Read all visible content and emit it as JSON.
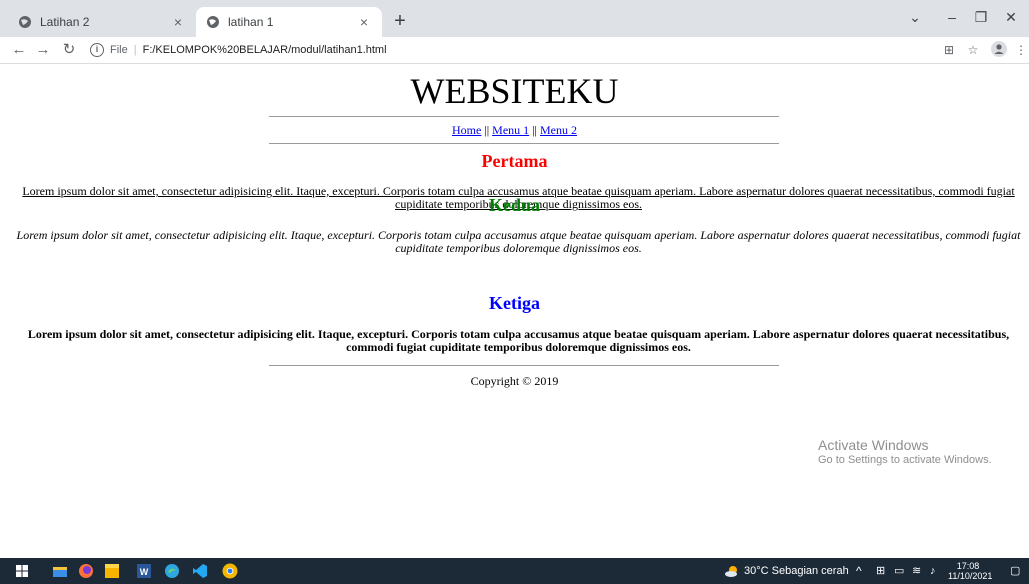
{
  "browser": {
    "tabs": [
      {
        "label": "Latihan 2",
        "close": "×",
        "active": false
      },
      {
        "label": "latihan 1",
        "close": "×",
        "active": true
      }
    ],
    "new_tab": "+",
    "window_controls": {
      "dropdown": "⌄",
      "minimize": "–",
      "restore": "❐",
      "close": "✕"
    },
    "url": {
      "scheme": "File",
      "path": "F:/KELOMPOK%20BELAJAR/modul/latihan1.html"
    }
  },
  "page": {
    "title": "WEBSITEKU",
    "nav": [
      {
        "label": "Home"
      },
      {
        "label": "Menu 1"
      },
      {
        "label": "Menu 2"
      }
    ],
    "nav_separator": "||",
    "sections": [
      {
        "heading": "Pertama",
        "color": "#ff0000",
        "text": "Lorem ipsum dolor sit amet, consectetur adipisicing elit. Itaque, excepturi. Corporis totam culpa accusamus atque beatae quisquam aperiam. Labore aspernatur dolores quaerat necessitatibus, commodi fugiat cupiditate temporibus doloremque dignissimos eos."
      },
      {
        "heading": "Kedua",
        "color": "#008000",
        "text": "Lorem ipsum dolor sit amet, consectetur adipisicing elit. Itaque, excepturi. Corporis totam culpa accusamus atque beatae quisquam aperiam. Labore aspernatur dolores quaerat necessitatibus, commodi fugiat cupiditate temporibus doloremque dignissimos eos."
      },
      {
        "heading": "Ketiga",
        "color": "#0000ff",
        "text": "Lorem ipsum dolor sit amet, consectetur adipisicing elit. Itaque, excepturi. Corporis totam culpa accusamus atque beatae quisquam aperiam. Labore aspernatur dolores quaerat necessitatibus, commodi fugiat cupiditate temporibus doloremque dignissimos eos."
      }
    ],
    "copyright": "Copyright © 2019"
  },
  "watermark": {
    "line1": "Activate Windows",
    "line2": "Go to Settings to activate Windows."
  },
  "taskbar": {
    "apps": [
      "windows-start-icon",
      "file-explorer-icon",
      "firefox-icon",
      "sticky-notes-icon",
      "word-icon",
      "edge-icon",
      "vscode-icon",
      "chrome-icon"
    ],
    "weather": "30°C  Sebagian cerah",
    "time": "17:08",
    "date": "11/10/2021"
  }
}
